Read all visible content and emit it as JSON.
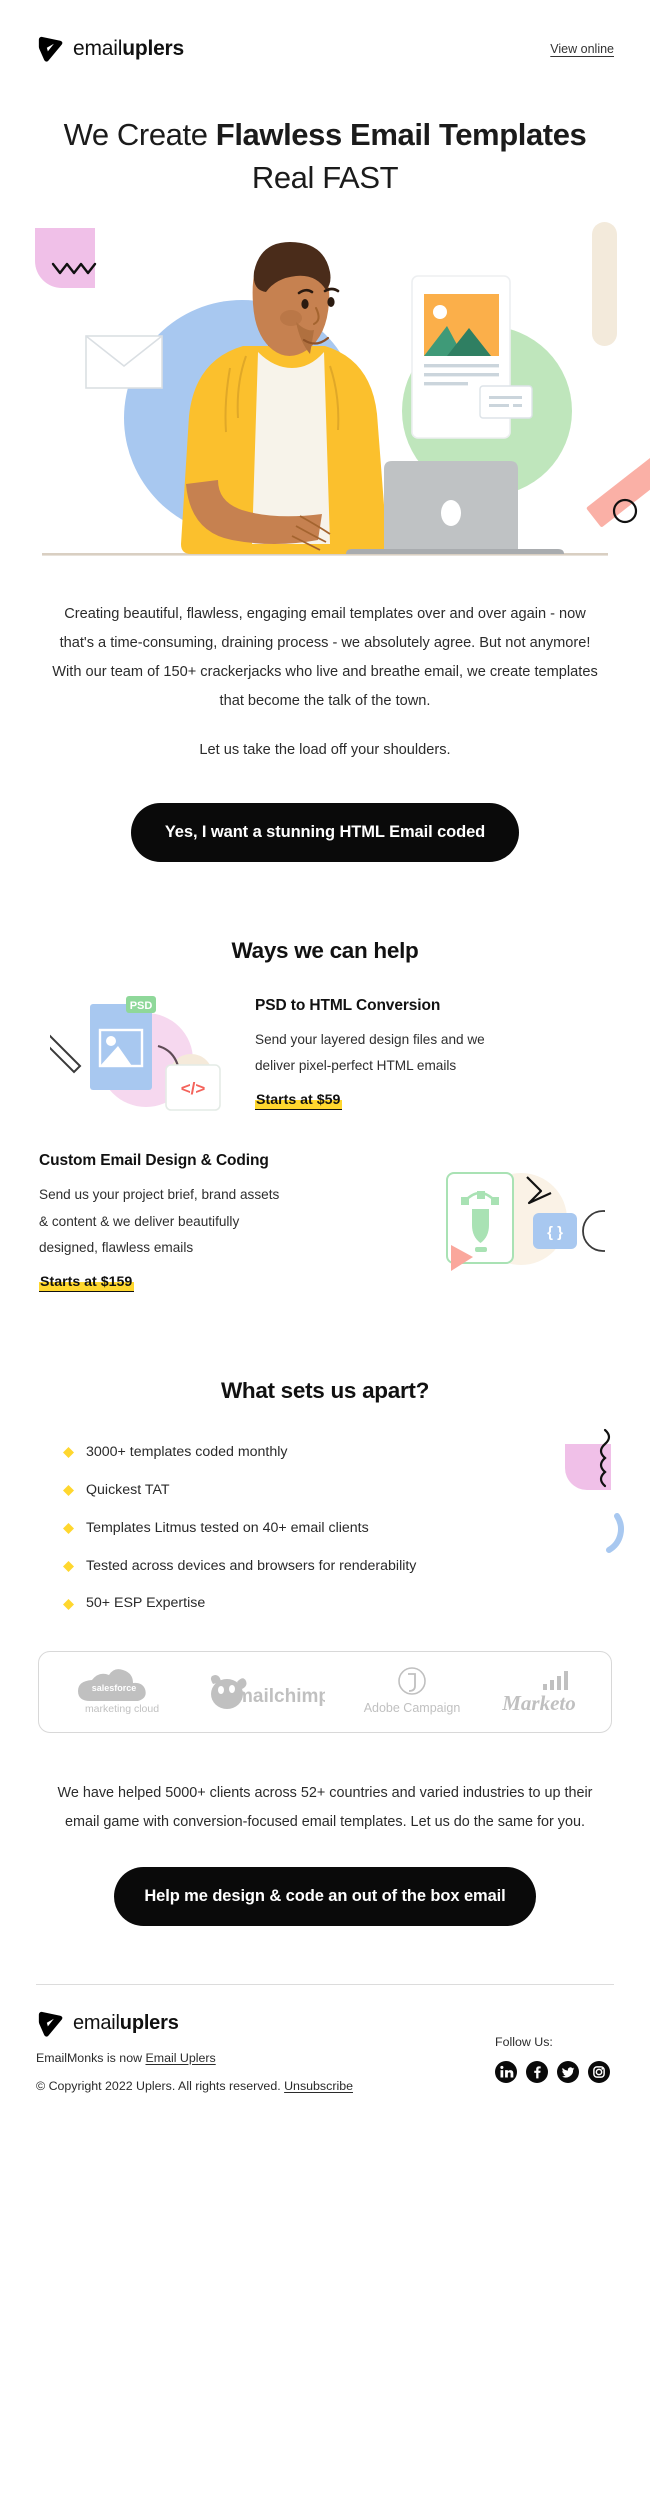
{
  "header": {
    "logo_word_light": "email",
    "logo_word_bold": "uplers",
    "logo_icon": "paper-plane-badge-icon",
    "view_online": "View online"
  },
  "headline": {
    "part1": "We Create ",
    "part2_bold": "Flawless Email Templates",
    "part3": " Real FAST"
  },
  "hero": {
    "alt": "illustration-man-at-laptop-designing-email",
    "colors": {
      "shirt_yellow": "#FBC02D",
      "shirt_yellow_dark": "#F0A92B",
      "skin": "#C68150",
      "skin_dark": "#B0703F",
      "hair": "#4A2C1A",
      "circle_blue": "#A8C8F0",
      "circle_green": "#BFE6BC",
      "leaf_pink": "#F0C0E8",
      "pill_cream": "#F3EADB",
      "bar_salmon": "#FAB0A6",
      "laptop_gray": "#BFC2C4",
      "image_orange": "#FBAF4A",
      "mountain_green": "#3F9A78",
      "shirt_white": "#F7F3EA"
    }
  },
  "intro": {
    "paragraph": "Creating beautiful, flawless, engaging email templates over and over again - now that's a time-consuming, draining process - we absolutely agree. But not anymore! With our team of 150+ crackerjacks who live and breathe email, we create templates that become the talk of the town.",
    "subline": "Let us take the load off your shoulders."
  },
  "cta_primary": {
    "label": "Yes, I want a stunning HTML Email coded"
  },
  "ways": {
    "title": "Ways we can help",
    "services": [
      {
        "title": "PSD to HTML Conversion",
        "description": "Send your layered design files and we deliver pixel-perfect HTML emails",
        "price": "Starts at $59",
        "art": "psd-to-code-icon",
        "badge_label": "PSD",
        "code_label": "</>"
      },
      {
        "title": "Custom Email Design & Coding",
        "description": "Send us your project brief, brand assets & content & we deliver beautifully designed, flawless emails",
        "price": "Starts at $159",
        "art": "pen-tool-code-icon",
        "code_label": "{ }"
      }
    ]
  },
  "apart": {
    "title": "What sets us apart?",
    "bullets": [
      "3000+ templates coded monthly",
      "Quickest TAT",
      "Templates Litmus tested on 40+ email clients",
      "Tested across devices and browsers for renderability",
      "50+ ESP Expertise"
    ],
    "bullet_marker_color": "#FFD72E"
  },
  "esp_logos": [
    {
      "name": "salesforce-marketing-cloud-logo",
      "line1": "salesforce",
      "line2": "marketing cloud"
    },
    {
      "name": "mailchimp-logo",
      "line1": "mailchimp",
      "line2": ""
    },
    {
      "name": "adobe-campaign-logo",
      "line1": "Adobe Campaign",
      "line2": ""
    },
    {
      "name": "marketo-logo",
      "line1": "Marketo",
      "line2": ""
    }
  ],
  "closing": {
    "paragraph": "We have helped 5000+ clients across 52+ countries and varied industries to up their email game with conversion-focused email templates. Let us do the same for you."
  },
  "cta_secondary": {
    "label": "Help me design & code an out of the box email"
  },
  "footer": {
    "logo_word_light": "email",
    "logo_word_bold": "uplers",
    "rebrand_prefix": "EmailMonks is now ",
    "rebrand_link": "Email Uplers",
    "copyright": "© Copyright 2022 Uplers. All rights reserved. ",
    "unsubscribe": "Unsubscribe",
    "follow_label": "Follow Us:",
    "socials": [
      {
        "name": "linkedin-icon",
        "glyph": "in"
      },
      {
        "name": "facebook-icon",
        "glyph": "f"
      },
      {
        "name": "twitter-icon",
        "glyph": "t"
      },
      {
        "name": "instagram-icon",
        "glyph": "ig"
      }
    ]
  }
}
